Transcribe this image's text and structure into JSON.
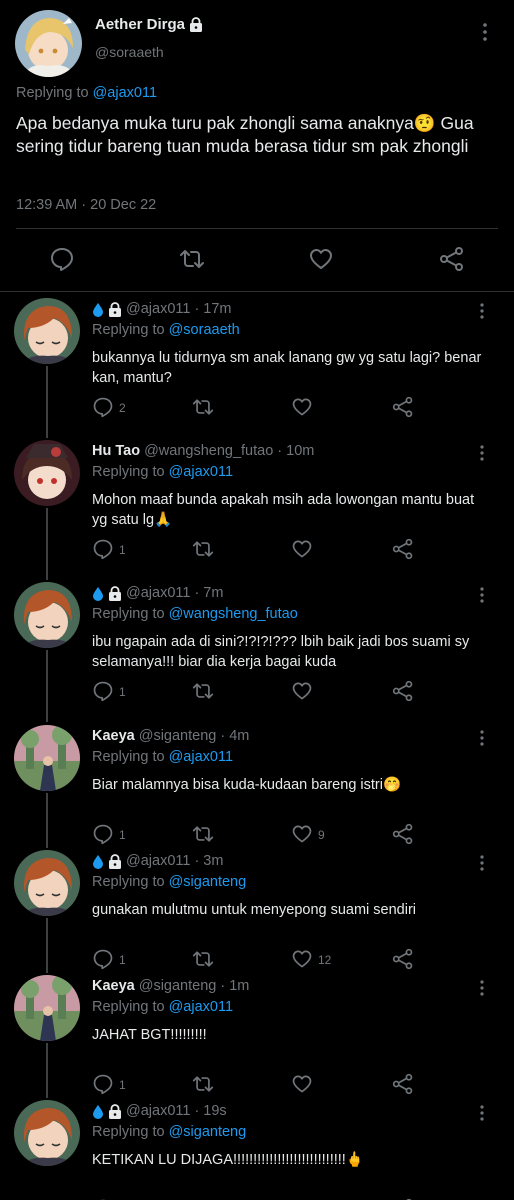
{
  "main_tweet": {
    "display_name": "Aether Dirga",
    "handle": "@soraaeth",
    "replying_prefix": "Replying to",
    "replying_to": "@ajax011",
    "text": "Apa bedanya muka turu pak zhongli sama anaknya🤨 Gua sering tidur bareng tuan muda berasa tidur sm pak zhongli",
    "timestamp": "12:39 AM · 20 Dec 22",
    "avatar_icon": "blonde-character-avatar"
  },
  "replies": [
    {
      "display_name": "",
      "badge_icons": [
        "droplet-icon",
        "lock-icon"
      ],
      "handle": "@ajax011",
      "age": "· 17m",
      "replying_prefix": "Replying to",
      "replying_to": "@soraaeth",
      "text": "bukannya lu tidurnya sm anak lanang gw yg satu lagi? benar kan, mantu?",
      "reply_count": "2",
      "like_count": ""
    },
    {
      "display_name": "Hu Tao",
      "badge_icons": [],
      "handle": "@wangsheng_futao",
      "age": "· 10m",
      "replying_prefix": "Replying to",
      "replying_to": "@ajax011",
      "text": "Mohon maaf bunda apakah msih ada lowongan mantu buat yg satu lg🙏",
      "reply_count": "1",
      "like_count": ""
    },
    {
      "display_name": "",
      "badge_icons": [
        "droplet-icon",
        "lock-icon"
      ],
      "handle": "@ajax011",
      "age": "· 7m",
      "replying_prefix": "Replying to",
      "replying_to": "@wangsheng_futao",
      "text": "ibu ngapain ada di sini?!?!?!??? lbih baik jadi bos suami sy selamanya!!! biar dia kerja bagai kuda",
      "reply_count": "1",
      "like_count": ""
    },
    {
      "display_name": "Kaeya",
      "badge_icons": [],
      "handle": "@siganteng",
      "age": "· 4m",
      "replying_prefix": "Replying to",
      "replying_to": "@ajax011",
      "text": "Biar malamnya bisa kuda-kudaan bareng istri🤭",
      "reply_count": "1",
      "like_count": "9"
    },
    {
      "display_name": "",
      "badge_icons": [
        "droplet-icon",
        "lock-icon"
      ],
      "handle": "@ajax011",
      "age": "· 3m",
      "replying_prefix": "Replying to",
      "replying_to": "@siganteng",
      "text": "gunakan mulutmu untuk menyepong suami sendiri",
      "reply_count": "1",
      "like_count": "12"
    },
    {
      "display_name": "Kaeya",
      "badge_icons": [],
      "handle": "@siganteng",
      "age": "· 1m",
      "replying_prefix": "Replying to",
      "replying_to": "@ajax011",
      "text": "JAHAT BGT!!!!!!!!!",
      "reply_count": "1",
      "like_count": ""
    },
    {
      "display_name": "",
      "badge_icons": [
        "droplet-icon",
        "lock-icon"
      ],
      "handle": "@ajax011",
      "age": "· 19s",
      "replying_prefix": "Replying to",
      "replying_to": "@siganteng",
      "text": "KETIKAN LU DIJAGA!!!!!!!!!!!!!!!!!!!!!!!!!!!!🖕",
      "reply_count": "",
      "like_count": ""
    }
  ],
  "colors": {
    "background": "#000000",
    "text": "#e7e9ea",
    "muted": "#71767b",
    "link": "#1d9bf0",
    "water_badge": "#1d9bf0"
  }
}
